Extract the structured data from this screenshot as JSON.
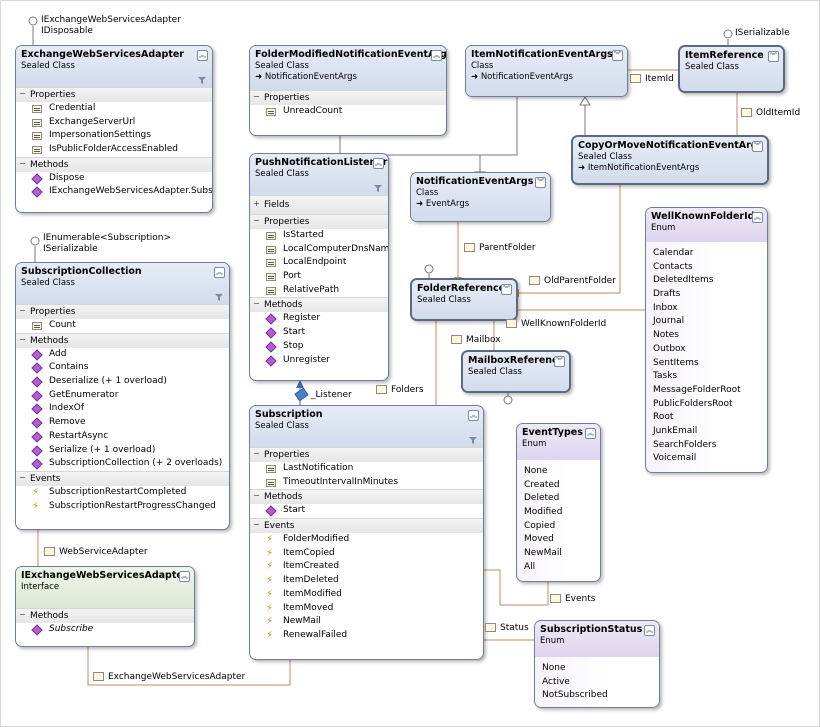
{
  "classes": {
    "ews_adapter": {
      "name": "ExchangeWebServicesAdapter",
      "kind": "Sealed Class",
      "interfaces": [
        "IExchangeWebServicesAdapter",
        "IDisposable"
      ],
      "sections": [
        {
          "title": "Properties",
          "members": [
            "Credential",
            "ExchangeServerUrl",
            "ImpersonationSettings",
            "IsPublicFolderAccessEnabled"
          ]
        },
        {
          "title": "Methods",
          "members": [
            "Dispose",
            "IExchangeWebServicesAdapter.Subsc..."
          ]
        }
      ]
    },
    "folder_modified_args": {
      "name": "FolderModifiedNotificationEventArgs",
      "kind": "Sealed Class",
      "base": "NotificationEventArgs",
      "sections": [
        {
          "title": "Properties",
          "members": [
            "UnreadCount"
          ]
        }
      ]
    },
    "item_notification_args": {
      "name": "ItemNotificationEventArgs",
      "kind": "Class",
      "base": "NotificationEventArgs"
    },
    "item_reference": {
      "name": "ItemReference",
      "kind": "Sealed Class",
      "interfaces": [
        "ISerializable"
      ]
    },
    "copy_or_move_args": {
      "name": "CopyOrMoveNotificationEventArgs",
      "kind": "Sealed Class",
      "base": "ItemNotificationEventArgs"
    },
    "push_listener": {
      "name": "PushNotificationListener",
      "kind": "Sealed Class",
      "sections": [
        {
          "title": "Fields",
          "collapsed": true,
          "members": []
        },
        {
          "title": "Properties",
          "members": [
            "IsStarted",
            "LocalComputerDnsName",
            "LocalEndpoint",
            "Port",
            "RelativePath"
          ]
        },
        {
          "title": "Methods",
          "members": [
            "Register",
            "Start",
            "Stop",
            "Unregister"
          ]
        }
      ]
    },
    "notification_args": {
      "name": "NotificationEventArgs",
      "kind": "Class",
      "base": "EventArgs"
    },
    "well_known_folder": {
      "name": "WellKnownFolderId",
      "kind": "Enum",
      "values": [
        "Calendar",
        "Contacts",
        "DeletedItems",
        "Drafts",
        "Inbox",
        "Journal",
        "Notes",
        "Outbox",
        "SentItems",
        "Tasks",
        "MessageFolderRoot",
        "PublicFoldersRoot",
        "Root",
        "JunkEmail",
        "SearchFolders",
        "Voicemail"
      ]
    },
    "subscription_collection": {
      "name": "SubscriptionCollection",
      "kind": "Sealed Class",
      "interfaces": [
        "IEnumerable<Subscription>",
        "ISerializable"
      ],
      "sections": [
        {
          "title": "Properties",
          "members": [
            "Count"
          ]
        },
        {
          "title": "Methods",
          "members": [
            "Add",
            "Contains",
            "Deserialize (+ 1 overload)",
            "GetEnumerator",
            "IndexOf",
            "Remove",
            "RestartAsync",
            "Serialize (+ 1 overload)",
            "SubscriptionCollection (+ 2 overloads)"
          ]
        },
        {
          "title": "Events",
          "members": [
            "SubscriptionRestartCompleted",
            "SubscriptionRestartProgressChanged"
          ]
        }
      ]
    },
    "folder_reference": {
      "name": "FolderReference",
      "kind": "Sealed Class"
    },
    "mailbox_reference": {
      "name": "MailboxReference",
      "kind": "Sealed Class"
    },
    "subscription": {
      "name": "Subscription",
      "kind": "Sealed Class",
      "sections": [
        {
          "title": "Properties",
          "members": [
            "LastNotification",
            "TimeoutIntervalInMinutes"
          ]
        },
        {
          "title": "Methods",
          "members": [
            "Start"
          ]
        },
        {
          "title": "Events",
          "members": [
            "FolderModified",
            "ItemCopied",
            "ItemCreated",
            "ItemDeleted",
            "ItemModified",
            "ItemMoved",
            "NewMail",
            "RenewalFailed"
          ]
        }
      ]
    },
    "event_types": {
      "name": "EventTypes",
      "kind": "Enum",
      "values": [
        "None",
        "Created",
        "Deleted",
        "Modified",
        "Copied",
        "Moved",
        "NewMail",
        "All"
      ]
    },
    "iews_adapter": {
      "name": "IExchangeWebServicesAdapter",
      "kind": "Interface",
      "sections": [
        {
          "title": "Methods",
          "members": [
            "Subscribe"
          ]
        }
      ]
    },
    "subscription_status": {
      "name": "SubscriptionStatus",
      "kind": "Enum",
      "values": [
        "None",
        "Active",
        "NotSubscribed"
      ]
    }
  },
  "associations": {
    "item_id": "ItemId",
    "old_item_id": "OldItemId",
    "parent_folder": "ParentFolder",
    "old_parent_folder": "OldParentFolder",
    "well_known_folder_id": "WellKnownFolderId",
    "mailbox": "Mailbox",
    "listener": "_Listener",
    "folders": "Folders",
    "web_service_adapter": "WebServiceAdapter",
    "events": "Events",
    "status": "Status",
    "exchange_web_services_adapter": "ExchangeWebServicesAdapter"
  }
}
